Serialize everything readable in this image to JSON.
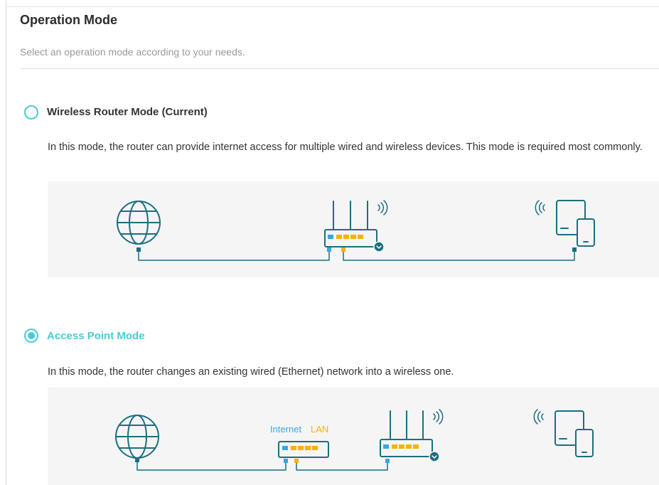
{
  "page": {
    "title": "Operation Mode",
    "subtitle": "Select an operation mode according to your needs."
  },
  "modes": [
    {
      "label": "Wireless Router Mode (Current)",
      "selected": false,
      "description": "In this mode, the router can provide internet access for multiple wired and wireless devices. This mode is required most commonly."
    },
    {
      "label": "Access Point Mode",
      "selected": true,
      "description": "In this mode, the router changes an existing wired (Ethernet) network into a wireless one."
    }
  ],
  "diagram_labels": {
    "internet": "Internet",
    "lan": "LAN"
  },
  "colors": {
    "accent": "#4acbd6",
    "icon_stroke": "#1a6f80",
    "internet_port": "#3aa6e0",
    "lan_port": "#f4b400",
    "diagram_bg": "#f5f5f5"
  }
}
